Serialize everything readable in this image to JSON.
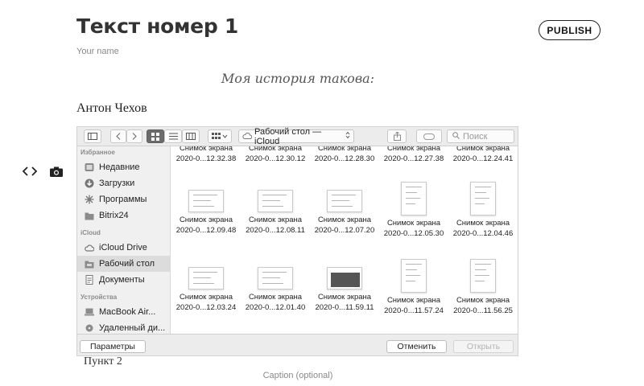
{
  "post": {
    "title": "Текст номер 1",
    "author_placeholder": "Your name",
    "publish_label": "PUBLISH",
    "subtitle": "Моя история такова:",
    "paragraph": "Антон Чехов",
    "paragraph_after": "Пункт 2",
    "caption_placeholder": "Caption (optional)"
  },
  "tools": {
    "embed_icon": "code-brackets-icon",
    "photo_icon": "camera-icon"
  },
  "finder": {
    "path_label": "Рабочий стол — iCloud",
    "search_placeholder": "Поиск",
    "sidebar": {
      "favorites_header": "Избранное",
      "favorites": [
        {
          "label": "Недавние",
          "icon": "clock-icon"
        },
        {
          "label": "Загрузки",
          "icon": "download-icon"
        },
        {
          "label": "Программы",
          "icon": "apps-icon"
        },
        {
          "label": "Bitrix24",
          "icon": "folder-icon"
        }
      ],
      "icloud_header": "iCloud",
      "icloud": [
        {
          "label": "iCloud Drive",
          "icon": "cloud-icon"
        },
        {
          "label": "Рабочий стол",
          "icon": "desktop-folder-icon"
        },
        {
          "label": "Документы",
          "icon": "documents-icon"
        }
      ],
      "devices_header": "Устройства",
      "devices": [
        {
          "label": "MacBook Air...",
          "icon": "laptop-icon"
        },
        {
          "label": "Удаленный ди...",
          "icon": "disk-icon"
        }
      ]
    },
    "files": [
      {
        "name": "Снимок экрана",
        "date": "2020-0...12.32.38",
        "thumb": "none"
      },
      {
        "name": "Снимок экрана",
        "date": "2020-0...12.30.12",
        "thumb": "none"
      },
      {
        "name": "Снимок экрана",
        "date": "2020-0...12.28.30",
        "thumb": "none"
      },
      {
        "name": "Снимок экрана",
        "date": "2020-0...12.27.38",
        "thumb": "none"
      },
      {
        "name": "Снимок экрана",
        "date": "2020-0...12.24.41",
        "thumb": "none"
      },
      {
        "name": "Снимок экрана",
        "date": "2020-0...12.09.48",
        "thumb": "wide"
      },
      {
        "name": "Снимок экрана",
        "date": "2020-0...12.08.11",
        "thumb": "wide"
      },
      {
        "name": "Снимок экрана",
        "date": "2020-0...12.07.20",
        "thumb": "wide"
      },
      {
        "name": "Снимок экрана",
        "date": "2020-0...12.05.30",
        "thumb": "tall"
      },
      {
        "name": "Снимок экрана",
        "date": "2020-0...12.04.46",
        "thumb": "tall"
      },
      {
        "name": "Снимок экрана",
        "date": "2020-0...12.03.24",
        "thumb": "wide"
      },
      {
        "name": "Снимок экрана",
        "date": "2020-0...12.01.40",
        "thumb": "wide"
      },
      {
        "name": "Снимок экрана",
        "date": "2020-0...11.59.11",
        "thumb": "dark"
      },
      {
        "name": "Снимок экрана",
        "date": "2020-0...11.57.24",
        "thumb": "tall"
      },
      {
        "name": "Снимок экрана",
        "date": "2020-0...11.56.25",
        "thumb": "tall"
      }
    ],
    "options_label": "Параметры",
    "cancel_label": "Отменить",
    "open_label": "Открыть"
  }
}
